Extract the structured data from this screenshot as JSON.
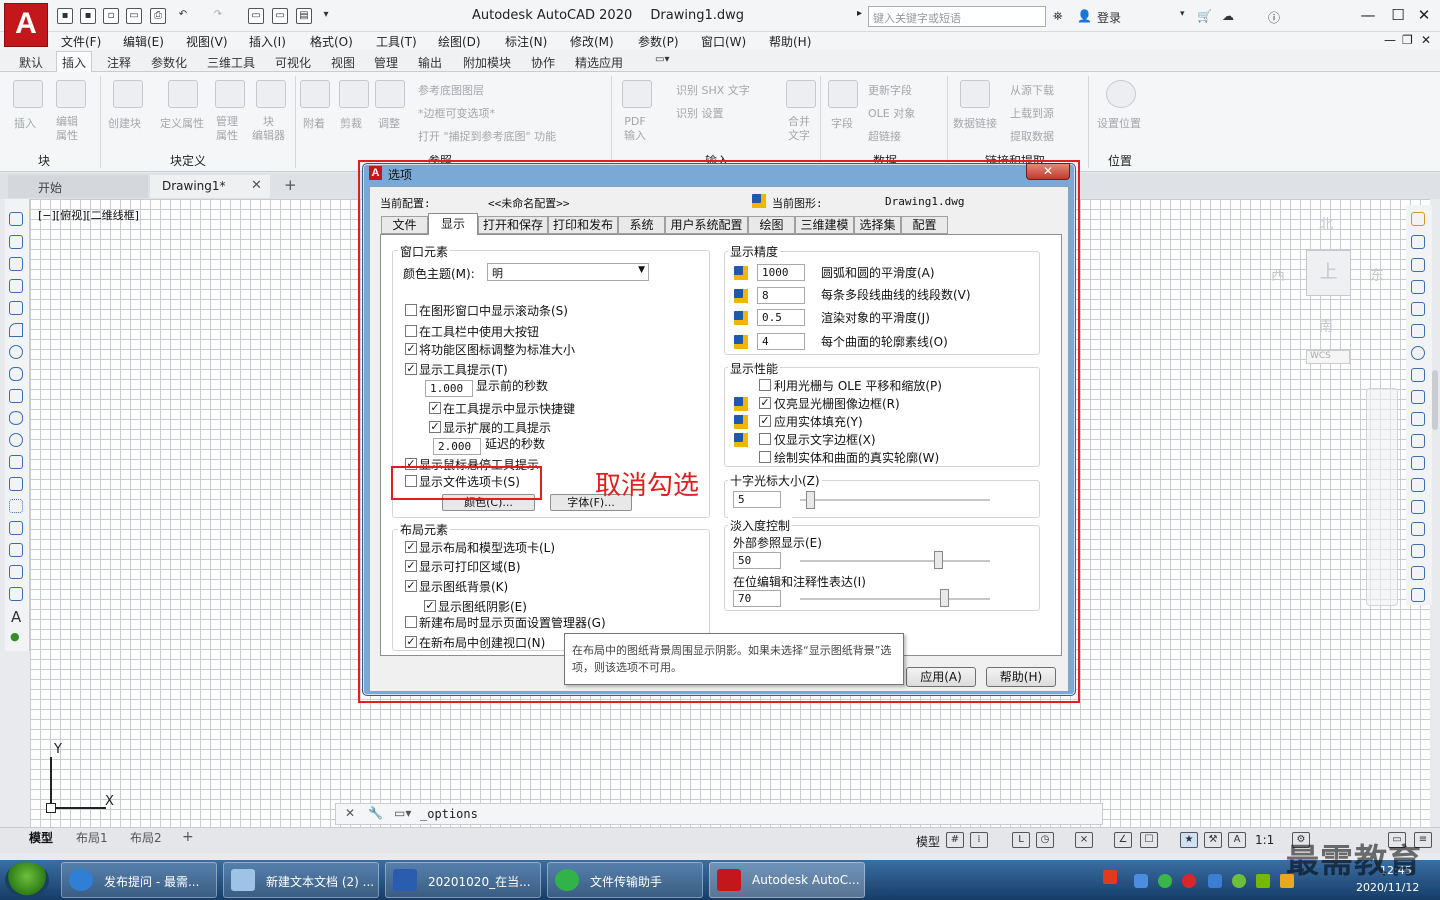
{
  "app": {
    "title": "Autodesk AutoCAD 2020",
    "drawing": "Drawing1.dwg",
    "logo": "A",
    "search_placeholder": "键入关键字或短语",
    "login": "登录"
  },
  "menu": [
    "文件(F)",
    "编辑(E)",
    "视图(V)",
    "插入(I)",
    "格式(O)",
    "工具(T)",
    "绘图(D)",
    "标注(N)",
    "修改(M)",
    "参数(P)",
    "窗口(W)",
    "帮助(H)"
  ],
  "ribbon_tabs": [
    "默认",
    "插入",
    "注释",
    "参数化",
    "三维工具",
    "可视化",
    "视图",
    "管理",
    "输出",
    "附加模块",
    "协作",
    "精选应用"
  ],
  "ribbon": {
    "insert": "插入",
    "edit_attr": "编辑\n属性",
    "create_block": "创建块",
    "define_attr": "定义属性",
    "manage_attr": "管理\n属性",
    "block_editor": "块\n编辑器",
    "attach": "附着",
    "clip": "剪裁",
    "adjust": "调整",
    "ref_layers": "参考底图图层",
    "frame_var": "*边框可变选项*",
    "snap_ref": "打开 \"捕捉到参考底图\" 功能",
    "pdf_import": "PDF\n输入",
    "shx": "识别 SHX 文字",
    "recog_settings": "识别 设置",
    "combine_text": "合并\n文字",
    "field": "字段",
    "update_field": "更新字段",
    "ole": "OLE 对象",
    "hyperlink": "超链接",
    "data_link": "数据链接",
    "download_source": "从源下载",
    "upload_source": "上载到源",
    "extract_data": "提取数据",
    "set_location": "设置位置",
    "panel_block": "块",
    "panel_block_def": "块定义",
    "panel_ref": "参照",
    "panel_import": "输入",
    "panel_data": "数据",
    "panel_link": "链接和提取",
    "panel_location": "位置"
  },
  "doc_tabs": {
    "start": "开始",
    "drawing": "Drawing1*"
  },
  "viewport_label": "[−][俯视][二维线框]",
  "viewcube": {
    "north": "北",
    "south": "南",
    "east": "东",
    "west": "西",
    "top": "上",
    "wcs": "WCS"
  },
  "ucs": {
    "x": "X",
    "y": "Y"
  },
  "command_text": "_options",
  "layout_tabs": [
    "模型",
    "布局1",
    "布局2"
  ],
  "status": {
    "model": "模型",
    "scale": "1:1"
  },
  "taskbar": {
    "items": [
      "发布提问 - 最需...",
      "新建文本文档 (2) ...",
      "20201020_在当...",
      "文件传输助手",
      "Autodesk AutoC..."
    ],
    "time": "12:45",
    "date": "2020/11/12"
  },
  "watermark": "最需教育",
  "dialog": {
    "title": "选项",
    "current_profile_label": "当前配置:",
    "current_profile_value": "<<未命名配置>>",
    "current_drawing_label": "当前图形:",
    "current_drawing_value": "Drawing1.dwg",
    "tabs": [
      "文件",
      "显示",
      "打开和保存",
      "打印和发布",
      "系统",
      "用户系统配置",
      "绘图",
      "三维建模",
      "选择集",
      "配置"
    ],
    "window_elements": {
      "title": "窗口元素",
      "color_scheme_label": "颜色主题(M):",
      "color_scheme_value": "明",
      "show_scrollbars": "在图形窗口中显示滚动条(S)",
      "large_buttons": "在工具栏中使用大按钮",
      "resize_ribbon_icons": "将功能区图标调整为标准大小",
      "show_tooltips": "显示工具提示(T)",
      "tooltip_delay_value": "1.000",
      "tooltip_delay_label": "显示前的秒数",
      "show_shortcut": "在工具提示中显示快捷键",
      "show_extended": "显示扩展的工具提示",
      "extended_delay_value": "2.000",
      "extended_delay_label": "延迟的秒数",
      "rollover_tooltips": "显示鼠标悬停工具提示",
      "show_file_tabs": "显示文件选项卡(S)",
      "colors_button": "颜色(C)...",
      "fonts_button": "字体(F)..."
    },
    "layout_elements": {
      "title": "布局元素",
      "show_layout_tabs": "显示布局和模型选项卡(L)",
      "show_printable": "显示可打印区域(B)",
      "show_paper_bg": "显示图纸背景(K)",
      "show_paper_shadow": "显示图纸阴影(E)",
      "show_page_setup": "新建布局时显示页面设置管理器(G)",
      "create_viewport": "在新布局中创建视口(N)"
    },
    "display_resolution": {
      "title": "显示精度",
      "arc_value": "1000",
      "arc_label": "圆弧和圆的平滑度(A)",
      "polyline_value": "8",
      "polyline_label": "每条多段线曲线的线段数(V)",
      "render_value": "0.5",
      "render_label": "渲染对象的平滑度(J)",
      "contour_value": "4",
      "contour_label": "每个曲面的轮廓素线(O)"
    },
    "display_performance": {
      "title": "显示性能",
      "raster_pan": "利用光栅与 OLE 平移和缩放(P)",
      "highlight_raster": "仅亮显光栅图像边框(R)",
      "solid_fill": "应用实体填充(Y)",
      "text_frame": "仅显示文字边框(X)",
      "silhouettes": "绘制实体和曲面的真实轮廓(W)"
    },
    "crosshair": {
      "title": "十字光标大小(Z)",
      "value": "5",
      "level": 0.05
    },
    "fade_control": {
      "title": "淡入度控制",
      "xref_label": "外部参照显示(E)",
      "xref_value": "50",
      "inplace_label": "在位编辑和注释性表达(I)",
      "inplace_value": "70"
    },
    "tooltip": "在布局中的图纸背景周围显示阴影。如果未选择“显示图纸背景”选项，则该选项不可用。",
    "apply_button": "应用(A)",
    "help_button": "帮助(H)",
    "annotation": "取消勾选"
  },
  "colors": {
    "accent_red": "#e02020",
    "autocad_red": "#c4171c",
    "grid": "#c9ccd1"
  }
}
